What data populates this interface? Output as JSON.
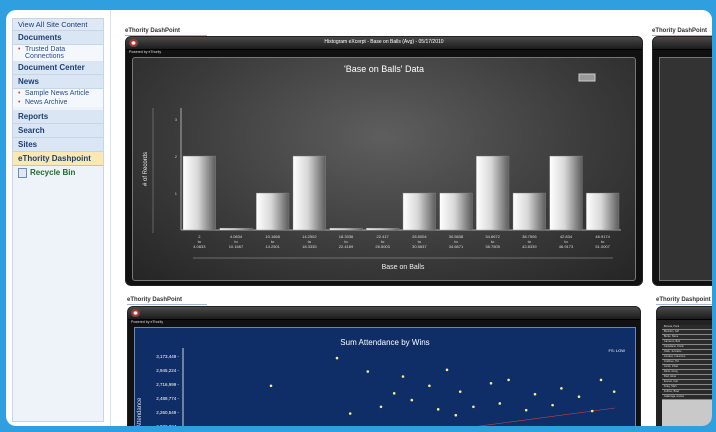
{
  "sidebar": {
    "view_all": "View All Site Content",
    "documents": "Documents",
    "trusted_data": "Trusted Data Connections",
    "document_center": "Document Center",
    "news": "News",
    "sample_news": "Sample News Article",
    "news_archive": "News Archive",
    "reports": "Reports",
    "search": "Search",
    "sites": "Sites",
    "ethority": "eThority Dashpoint",
    "recycle_bin": "Recycle Bin"
  },
  "webparts": {
    "title_top_left": "eThority DashPoint",
    "title_top_right": "eThority DashPoint",
    "title_bottom_left": "eThority DashPoint",
    "title_bottom_right": "eThority Dashpoint"
  },
  "histogram_panel": {
    "window_title": "Histogram eXcerpt - Base on Balls (Avg) - 05/17/2010",
    "powered": "Powered by eThority"
  },
  "attendance_panel": {
    "powered": "Powered by eThority",
    "legend": "FS: LOW"
  },
  "colors": {
    "page_bg": "#2f9fe0",
    "chart_bg": "#3a3a3a",
    "blue_bg": "#0f2d66",
    "accent_active": "#fde7b3"
  },
  "chart_data": [
    {
      "type": "bar",
      "title": "'Base on Balls' Data",
      "xlabel": "Base on Balls",
      "ylabel": "# of Records",
      "yticks": [
        "3",
        "2",
        "1"
      ],
      "ylim": [
        0,
        3.3
      ],
      "categories": [
        [
          "2",
          "to",
          "4.0833"
        ],
        [
          "4.0834",
          "to",
          "10.1667"
        ],
        [
          "10.1668",
          "to",
          "14.2501"
        ],
        [
          "14.2502",
          "to",
          "18.3335"
        ],
        [
          "18.3336",
          "to",
          "22.4169"
        ],
        [
          "22.417",
          "to",
          "26.5003"
        ],
        [
          "26.5004",
          "to",
          "30.5837"
        ],
        [
          "30.5838",
          "to",
          "34.6671"
        ],
        [
          "34.6672",
          "to",
          "38.7505"
        ],
        [
          "38.7506",
          "to",
          "42.8339"
        ],
        [
          "42.834",
          "to",
          "46.9173"
        ],
        [
          "46.9174",
          "to",
          "51.0007"
        ]
      ],
      "values": [
        2,
        0.05,
        1,
        2,
        0.05,
        0.05,
        1,
        1,
        2,
        1,
        2,
        1
      ]
    },
    {
      "type": "scatter",
      "title": "Sum Attendance by Wins",
      "ylabel": "Attendance",
      "yticks": [
        "3,173,449",
        "2,945,224",
        "2,716,999",
        "2,488,774",
        "2,260,549",
        "2,032,324"
      ],
      "points": [
        [
          0.35,
          0.88
        ],
        [
          0.42,
          0.72
        ],
        [
          0.5,
          0.66
        ],
        [
          0.56,
          0.55
        ],
        [
          0.6,
          0.74
        ],
        [
          0.63,
          0.48
        ],
        [
          0.7,
          0.58
        ],
        [
          0.74,
          0.62
        ],
        [
          0.8,
          0.45
        ],
        [
          0.86,
          0.52
        ],
        [
          0.9,
          0.42
        ],
        [
          0.52,
          0.38
        ],
        [
          0.45,
          0.3
        ],
        [
          0.66,
          0.3
        ],
        [
          0.72,
          0.34
        ],
        [
          0.58,
          0.27
        ],
        [
          0.84,
          0.32
        ],
        [
          0.95,
          0.62
        ],
        [
          0.98,
          0.48
        ],
        [
          0.38,
          0.22
        ],
        [
          0.78,
          0.26
        ],
        [
          0.93,
          0.25
        ],
        [
          0.48,
          0.46
        ],
        [
          0.62,
          0.2
        ],
        [
          0.2,
          0.55
        ]
      ]
    }
  ],
  "table_rows": [
    "Bonura, Huck",
    "Bourdon, Jeff",
    "Burke, Steve",
    "Cameron, Bob",
    "Castellano, Frank",
    "Clark, Jermaine",
    "Cordero, Francisco",
    "Crabtree, Tim",
    "Curtis, Chad",
    "Davis, Doug",
    "Diaz, Einar",
    "Everett, Carl",
    "Foley, Marv",
    "Fullmer, Brad",
    "Galarraga, Andres"
  ]
}
